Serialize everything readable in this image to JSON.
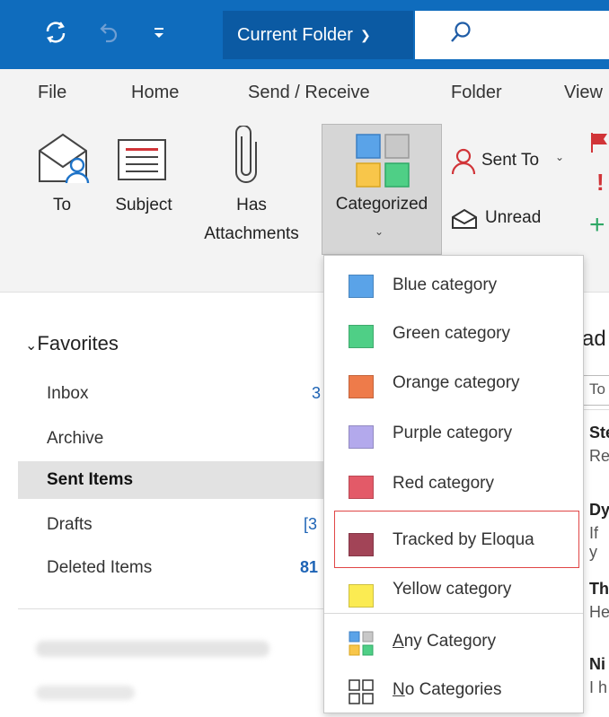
{
  "title_bar": {
    "folder_scope": "Current Folder"
  },
  "tabs": [
    "File",
    "Home",
    "Send / Receive",
    "Folder",
    "View"
  ],
  "ribbon": {
    "to": "To",
    "subject": "Subject",
    "has_attachments_1": "Has",
    "has_attachments_2": "Attachments",
    "categorized": "Categorized",
    "sent_to": "Sent To",
    "unread": "Unread"
  },
  "nav": {
    "favorites": "Favorites",
    "items": [
      {
        "label": "Inbox",
        "count": "3"
      },
      {
        "label": "Archive",
        "count": ""
      },
      {
        "label": "Sent Items",
        "count": ""
      },
      {
        "label": "Drafts",
        "count": "[3"
      },
      {
        "label": "Deleted Items",
        "count": "81"
      }
    ]
  },
  "message_list": {
    "header_fragment": "ad",
    "filter_fragment": "To",
    "rows": [
      {
        "line1": "Ste",
        "line2": "Re"
      },
      {
        "line1": "Dy",
        "line2": "If y"
      },
      {
        "line1": "Th",
        "line2": "He"
      },
      {
        "line1": "Ni",
        "line2": "I h"
      }
    ]
  },
  "category_menu": {
    "items": [
      {
        "label": "Blue category",
        "color": "#5aa3e8"
      },
      {
        "label": "Green category",
        "color": "#4fcf86"
      },
      {
        "label": "Orange category",
        "color": "#ee7b4a"
      },
      {
        "label": "Purple category",
        "color": "#b3a9ec"
      },
      {
        "label": "Red category",
        "color": "#e35a68"
      },
      {
        "label": "Tracked by Eloqua",
        "color": "#a24457"
      },
      {
        "label": "Yellow category",
        "color": "#fbeb52"
      }
    ],
    "any_category_u": "A",
    "any_category_rest": "ny Category",
    "no_categories_u": "N",
    "no_categories_rest": "o Categories"
  },
  "colors": {
    "brand_blue": "#0f6cbd",
    "highlight_red": "#e04646"
  }
}
